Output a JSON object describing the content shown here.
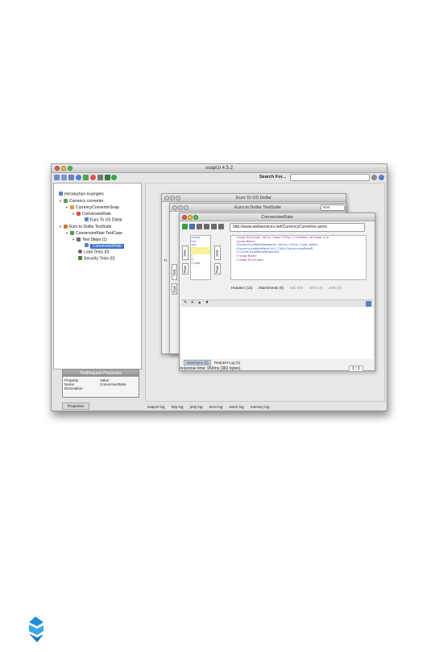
{
  "window": {
    "title": "soapUI 4.5.2"
  },
  "toolbar": {
    "search_label": "Search For...",
    "search_value": ""
  },
  "navigator": {
    "project_root": "Introduction examples",
    "items": [
      {
        "label": "Currency converter",
        "level": 1
      },
      {
        "label": "CurrencyConvertorSoap",
        "level": 2
      },
      {
        "label": "ConversionRate",
        "level": 3
      },
      {
        "label": "Euro To US Dollar",
        "level": 4
      },
      {
        "label": "Euro to Dollar TestSuite",
        "level": 1
      },
      {
        "label": "ConversionRate TestCase",
        "level": 2
      },
      {
        "label": "Test Steps (1)",
        "level": 3
      },
      {
        "label": "ConversionRate",
        "level": 4,
        "selected": true
      },
      {
        "label": "Load Tests (0)",
        "level": 3
      },
      {
        "label": "Security Tests (0)",
        "level": 3
      }
    ]
  },
  "properties_panel": {
    "title": "TestRequest Properties",
    "col_property": "Property",
    "col_value": "Value",
    "rows": [
      {
        "name": "Name",
        "value": "ConversionRate"
      },
      {
        "name": "Description",
        "value": ""
      }
    ],
    "tab_label": "Properties"
  },
  "log_tabs": [
    "soapUI log",
    "http log",
    "jetty log",
    "error log",
    "wsrm log",
    "memory log"
  ],
  "windows": {
    "back": {
      "title": "Euro To US Dollar"
    },
    "middle": {
      "title": "Euro to Dollar TestSuite",
      "combo_value": "sms"
    },
    "front": {
      "title": "ConversionRate",
      "url": "http://www.webservicex.net/CurrencyConvertor.asmx",
      "left_code": [
        "<soap",
        "<se",
        "<se",
        "",
        "<",
        "</",
        "</soa"
      ],
      "right_code": [
        "<soap:Envelope xmlns:soap=\"http://schemas.xmlsoap.org",
        "  <soap:Body>",
        "    <ConversionRateResponse xmlns=\"http://www.webse",
        "      <ConversionRateResult>1.218</ConversionRateR",
        "    </ConversionRateResponse>",
        "  </soap:Body>",
        "</soap:Envelope>"
      ],
      "headers_label": "Headers (13)",
      "attachments_label": "Attachments (0)",
      "ssl_label": "SSL Info",
      "wss_label": "WSS (0)",
      "jms_label": "JMS (0)",
      "assertions_tab": "Assertions (0)",
      "request_log_tab": "Request Log (1)",
      "response_time": "response time: 950ms (381 bytes)",
      "position": "1 : 1",
      "side_tabs": [
        "Raw",
        "XML",
        "Raw",
        "XML"
      ]
    },
    "stack_label": "Tr"
  }
}
